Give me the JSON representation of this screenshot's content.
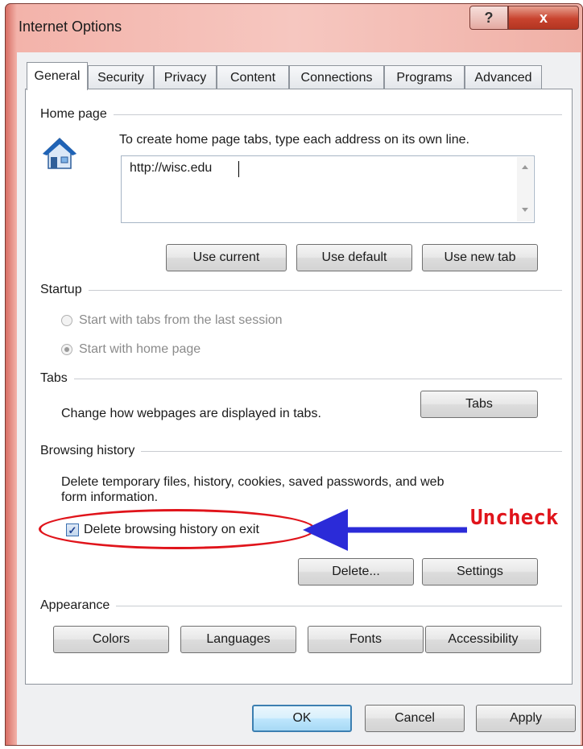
{
  "window": {
    "title": "Internet Options",
    "help_glyph": "?",
    "close_glyph": "x"
  },
  "tabs": [
    "General",
    "Security",
    "Privacy",
    "Content",
    "Connections",
    "Programs",
    "Advanced"
  ],
  "home_page": {
    "heading": "Home page",
    "instruction": "To create home page tabs, type each address on its own line.",
    "value": "http://wisc.edu",
    "buttons": {
      "use_current": "Use current",
      "use_default": "Use default",
      "use_new_tab": "Use new tab"
    }
  },
  "startup": {
    "heading": "Startup",
    "option_last_session": "Start with tabs from the last session",
    "option_home_page": "Start with home page",
    "selected": "home_page"
  },
  "tabs_group": {
    "heading": "Tabs",
    "description": "Change how webpages are displayed in tabs.",
    "button": "Tabs"
  },
  "browsing_history": {
    "heading": "Browsing history",
    "description_line1": "Delete temporary files, history, cookies, saved passwords, and web",
    "description_line2": "form information.",
    "checkbox_label": "Delete browsing history on exit",
    "checked": true,
    "delete_button": "Delete...",
    "settings_button": "Settings"
  },
  "appearance": {
    "heading": "Appearance",
    "buttons": {
      "colors": "Colors",
      "languages": "Languages",
      "fonts": "Fonts",
      "accessibility": "Accessibility"
    }
  },
  "footer": {
    "ok": "OK",
    "cancel": "Cancel",
    "apply": "Apply"
  },
  "annotation": {
    "text": "Uncheck",
    "color": "#e0141b",
    "arrow_color": "#2b2bd8"
  }
}
